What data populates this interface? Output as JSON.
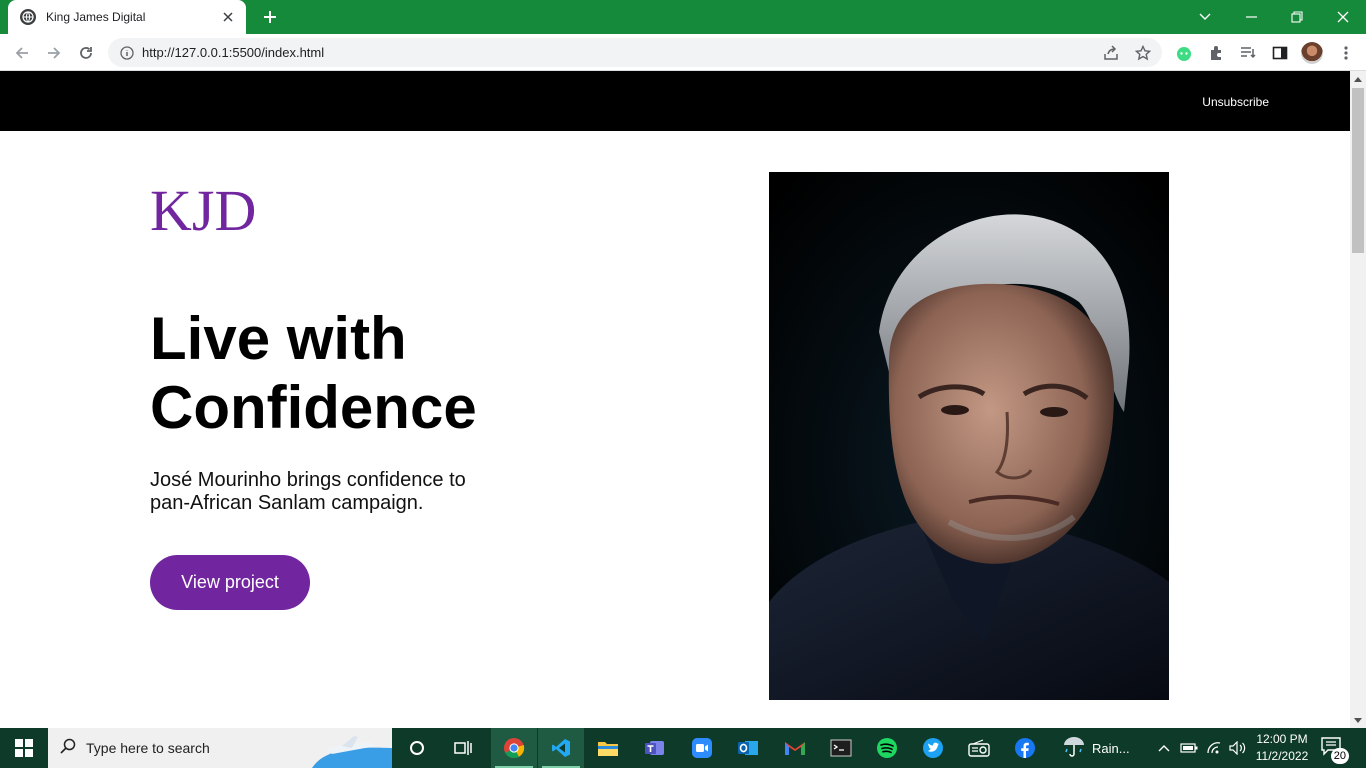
{
  "browser": {
    "tab_title": "King James Digital",
    "url": "http://127.0.0.1:5500/index.html"
  },
  "page": {
    "header_link": "Unsubscribe",
    "logo_text": "KJD",
    "headline_line1": "Live with",
    "headline_line2": "Confidence",
    "subtext": "José Mourinho brings confidence to pan-African Sanlam campaign.",
    "cta_label": "View project",
    "brand_color": "#7126a0"
  },
  "taskbar": {
    "search_placeholder": "Type here to search",
    "weather_text": "Rain...",
    "time": "12:00 PM",
    "date": "11/2/2022",
    "notification_count": "20"
  }
}
